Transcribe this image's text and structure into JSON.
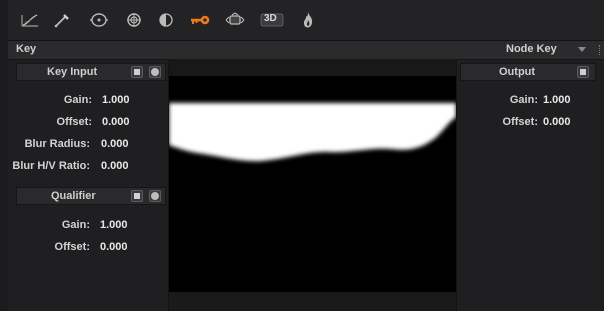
{
  "toolbar": {
    "tools": [
      {
        "icon": "curves-icon",
        "active": false
      },
      {
        "icon": "picker-icon",
        "active": false
      },
      {
        "icon": "window-icon",
        "active": false
      },
      {
        "icon": "tracker-icon",
        "active": false
      },
      {
        "icon": "blur-icon",
        "active": false
      },
      {
        "icon": "key-icon",
        "active": true
      },
      {
        "icon": "sizing-icon",
        "active": false
      },
      {
        "icon": "stereo-3d-icon",
        "active": false,
        "label": "3D"
      },
      {
        "icon": "flame-icon",
        "active": false
      }
    ],
    "accent": "#f07a1a"
  },
  "header": {
    "title": "Key",
    "mode_select": "Node Key"
  },
  "key_input": {
    "title": "Key Input",
    "params": [
      {
        "label": "Gain:",
        "value": "1.000"
      },
      {
        "label": "Offset:",
        "value": "0.000"
      },
      {
        "label": "Blur Radius:",
        "value": "0.000"
      },
      {
        "label": "Blur H/V Ratio:",
        "value": "0.000"
      }
    ]
  },
  "qualifier": {
    "title": "Qualifier",
    "params": [
      {
        "label": "Gain:",
        "value": "1.000"
      },
      {
        "label": "Offset:",
        "value": "0.000"
      }
    ]
  },
  "output": {
    "title": "Output",
    "params": [
      {
        "label": "Gain:",
        "value": "1.000"
      },
      {
        "label": "Offset:",
        "value": "0.000"
      }
    ]
  }
}
